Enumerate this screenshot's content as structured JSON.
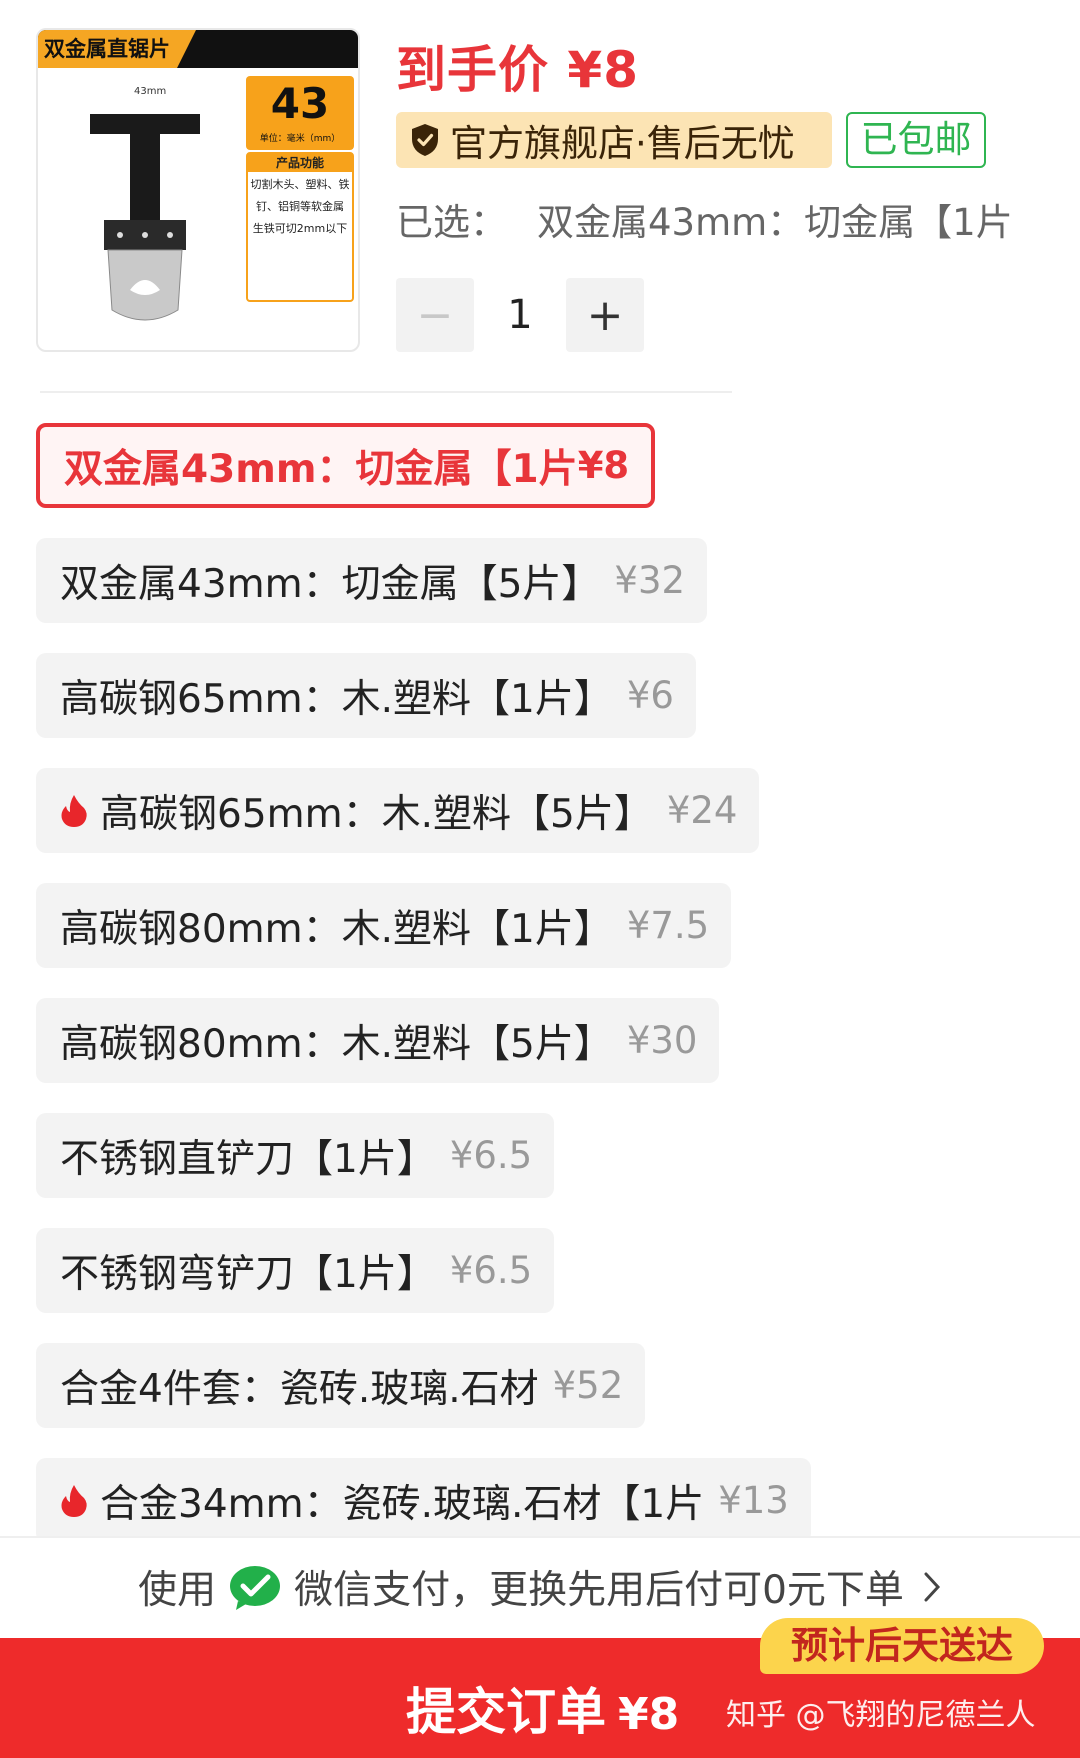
{
  "product": {
    "thumb_banner": "双金属直锯片",
    "thumb_size_label": "43mm",
    "thumb_badge_number": "43",
    "thumb_badge_unit": "单位：毫米（mm）",
    "thumb_func_title": "产品功能",
    "thumb_func_text": "切割木头、塑料、铁钉、铝铜等软金属 生铁可切2mm以下",
    "price_text": "到手价 ¥8",
    "official_badge": "官方旗舰店·售后无忧",
    "free_shipping": "已包邮",
    "selected_label": "已选：",
    "selected_value": "双金属43mm：切金属【1片"
  },
  "stepper": {
    "minus": "−",
    "value": "1",
    "plus": "+"
  },
  "options": [
    {
      "label": "双金属43mm：切金属【1片",
      "price": "¥8",
      "selected": true,
      "hot": false
    },
    {
      "label": "双金属43mm：切金属【5片】",
      "price": "¥32",
      "selected": false,
      "hot": false
    },
    {
      "label": "高碳钢65mm：木.塑料【1片】",
      "price": "¥6",
      "selected": false,
      "hot": false
    },
    {
      "label": "高碳钢65mm：木.塑料【5片】",
      "price": "¥24",
      "selected": false,
      "hot": true
    },
    {
      "label": "高碳钢80mm：木.塑料【1片】",
      "price": "¥7.5",
      "selected": false,
      "hot": false
    },
    {
      "label": "高碳钢80mm：木.塑料【5片】",
      "price": "¥30",
      "selected": false,
      "hot": false
    },
    {
      "label": "不锈钢直铲刀【1片】",
      "price": "¥6.5",
      "selected": false,
      "hot": false
    },
    {
      "label": "不锈钢弯铲刀【1片】",
      "price": "¥6.5",
      "selected": false,
      "hot": false
    },
    {
      "label": "合金4件套：瓷砖.玻璃.石材",
      "price": "¥52",
      "selected": false,
      "hot": false
    },
    {
      "label": "合金34mm：瓷砖.玻璃.石材【1片",
      "price": "¥13",
      "selected": false,
      "hot": true
    }
  ],
  "payment": {
    "prefix": "使用",
    "suffix": "微信支付，更换先用后付可0元下单",
    "icon": "wechat-icon"
  },
  "submit": {
    "label": "提交订单",
    "price": "¥8",
    "delivery": "预计后天送达",
    "watermark": "知乎 @飞翔的尼德兰人"
  },
  "colors": {
    "accent_red": "#e8353a",
    "submit_red": "#ee2b2b",
    "green": "#2fb551",
    "badge_yellow": "#fcd44c"
  }
}
